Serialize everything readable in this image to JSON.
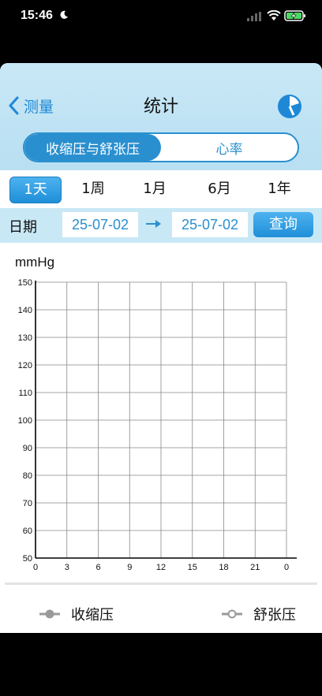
{
  "status_bar": {
    "time": "15:46"
  },
  "nav": {
    "back_label": "测量",
    "title": "统计"
  },
  "tabs": [
    {
      "label": "收缩压与舒张压",
      "active": true
    },
    {
      "label": "心率",
      "active": false
    }
  ],
  "periods": [
    {
      "label": "1天",
      "active": true
    },
    {
      "label": "1周",
      "active": false
    },
    {
      "label": "1月",
      "active": false
    },
    {
      "label": "6月",
      "active": false
    },
    {
      "label": "1年",
      "active": false
    }
  ],
  "date_filter": {
    "label": "日期",
    "start": "25-07-02",
    "end": "25-07-02",
    "query_label": "查询"
  },
  "chart_data": {
    "type": "line",
    "ylabel": "mmHg",
    "xlabel": "",
    "x_ticks": [
      "0",
      "3",
      "6",
      "9",
      "12",
      "15",
      "18",
      "21",
      "0"
    ],
    "y_ticks": [
      50,
      60,
      70,
      80,
      90,
      100,
      110,
      120,
      130,
      140,
      150
    ],
    "ylim": [
      50,
      150
    ],
    "xlim": [
      0,
      24
    ],
    "grid": true,
    "series": [
      {
        "name": "收缩压",
        "values": []
      },
      {
        "name": "舒张压",
        "values": []
      }
    ]
  },
  "legend": [
    {
      "label": "收缩压",
      "color": "#9a9a9a",
      "marker": "filled-circle"
    },
    {
      "label": "舒张压",
      "color": "#9a9a9a",
      "marker": "hollow-circle"
    }
  ],
  "colors": {
    "accent": "#2a8fcf",
    "header_bg": "#c9e8f6"
  }
}
